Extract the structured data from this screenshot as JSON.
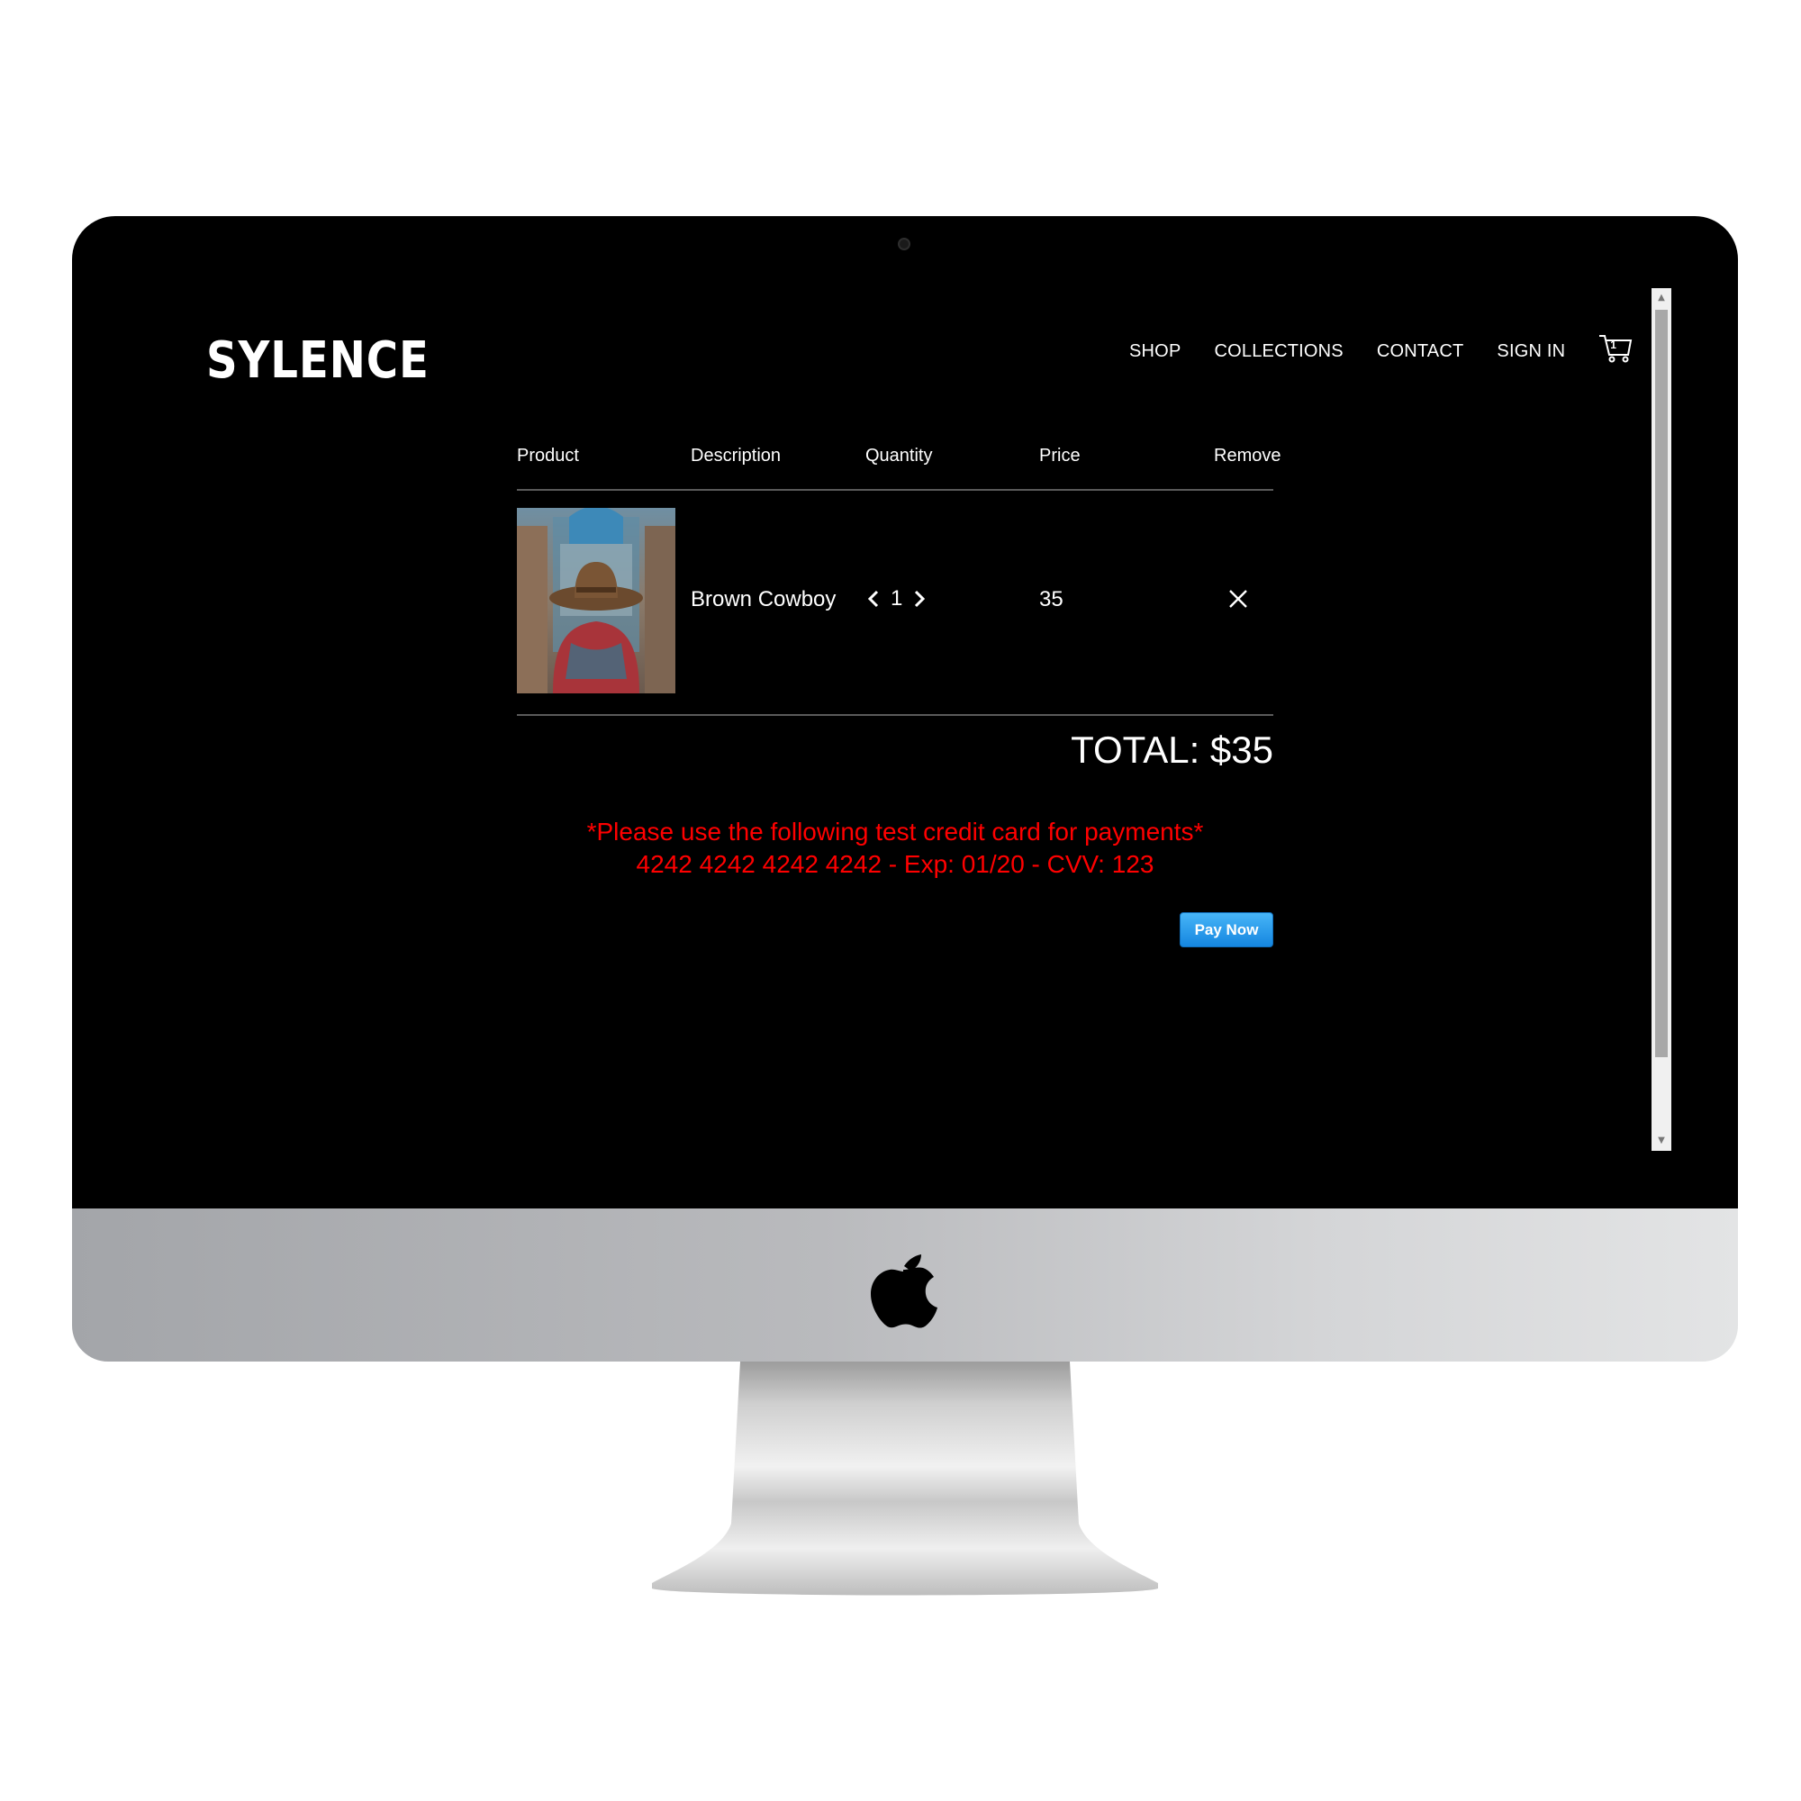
{
  "header": {
    "logo": "SYLENCE",
    "nav": [
      "SHOP",
      "COLLECTIONS",
      "CONTACT",
      "SIGN IN"
    ],
    "cart_count": "1"
  },
  "cart": {
    "columns": [
      "Product",
      "Description",
      "Quantity",
      "Price",
      "Remove"
    ],
    "items": [
      {
        "description": "Brown Cowboy",
        "quantity": "1",
        "price": "35"
      }
    ],
    "total": "TOTAL: $35"
  },
  "notice": {
    "line1": "*Please use the following test credit card for payments*",
    "line2": "4242 4242 4242 4242 - Exp: 01/20 - CVV: 123"
  },
  "pay_button": "Pay Now",
  "colors": {
    "background": "#000000",
    "text": "#ffffff",
    "notice": "#ff0000",
    "pay_button": "#1e8fe8"
  },
  "icons": [
    "cart-icon",
    "chevron-left-icon",
    "chevron-right-icon",
    "close-icon",
    "apple-logo-icon",
    "camera-icon"
  ]
}
